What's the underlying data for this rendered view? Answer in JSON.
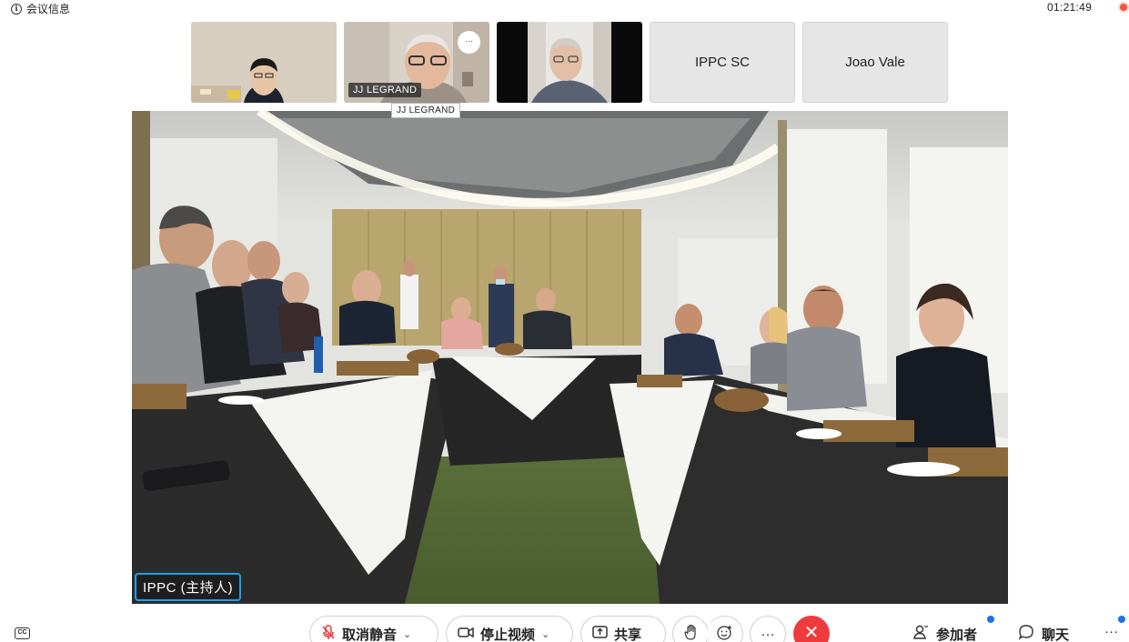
{
  "topbar": {
    "meeting_info_label": "会议信息",
    "info_icon": "info-icon",
    "timer": "01:21:49",
    "recording_color": "#f4523b"
  },
  "participants": [
    {
      "id": "p1",
      "type": "video"
    },
    {
      "id": "p2",
      "type": "video",
      "name": "JJ LEGRAND",
      "more": "···"
    },
    {
      "id": "p3",
      "type": "video"
    },
    {
      "id": "p4",
      "type": "text",
      "name": "IPPC SC"
    },
    {
      "id": "p5",
      "type": "text",
      "name": "Joao Vale"
    }
  ],
  "tooltip": "JJ LEGRAND",
  "main_video": {
    "host_label": "IPPC (主持人)",
    "accent_color": "#1aa1f0"
  },
  "toolbar": {
    "cc_label": "CC",
    "unmute_label": "取消静音",
    "stop_video_label": "停止视频",
    "share_label": "共享",
    "raise_hand_icon": "hand-icon",
    "reaction_icon": "smile-plus-icon",
    "more_label": "···",
    "end_icon": "close-icon",
    "end_color": "#ef3b3b",
    "participants_label": "参加者",
    "chat_label": "聊天",
    "overflow_label": "···"
  }
}
